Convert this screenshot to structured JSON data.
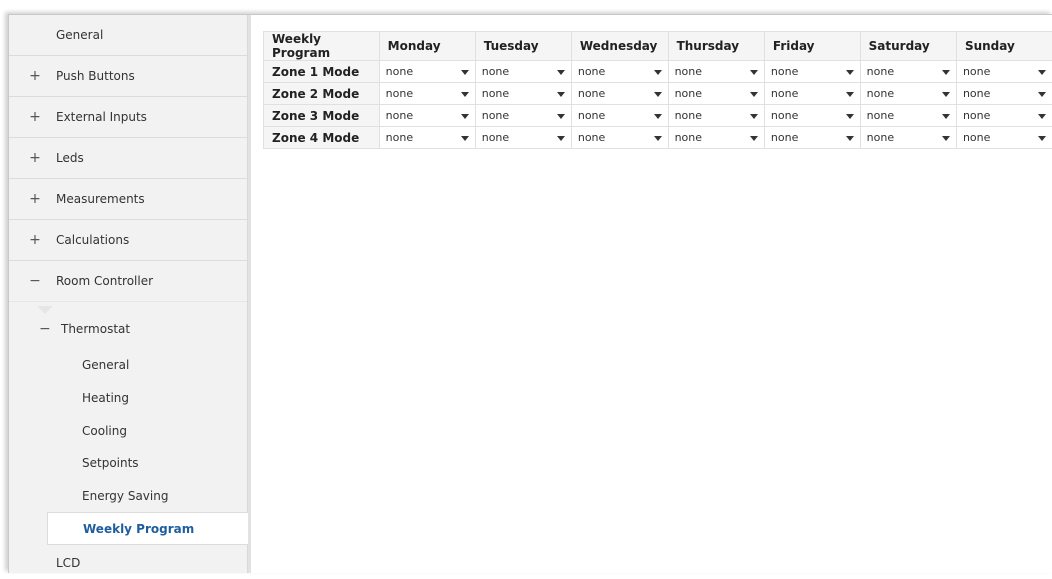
{
  "sidebar": {
    "items": [
      {
        "label": "General",
        "symbol": ""
      },
      {
        "label": "Push Buttons",
        "symbol": "+"
      },
      {
        "label": "External Inputs",
        "symbol": "+"
      },
      {
        "label": "Leds",
        "symbol": "+"
      },
      {
        "label": "Measurements",
        "symbol": "+"
      },
      {
        "label": "Calculations",
        "symbol": "+"
      },
      {
        "label": "Room Controller",
        "symbol": "−"
      }
    ],
    "thermostat": {
      "label": "Thermostat",
      "symbol": "−"
    },
    "sub_items": [
      {
        "label": "General"
      },
      {
        "label": "Heating"
      },
      {
        "label": "Cooling"
      },
      {
        "label": "Setpoints"
      },
      {
        "label": "Energy Saving"
      },
      {
        "label": "Weekly Program"
      }
    ],
    "lcd": {
      "label": "LCD"
    }
  },
  "table": {
    "header_label": "Weekly Program",
    "days": [
      "Monday",
      "Tuesday",
      "Wednesday",
      "Thursday",
      "Friday",
      "Saturday",
      "Sunday"
    ],
    "rows": [
      {
        "label": "Zone 1 Mode",
        "values": [
          "none",
          "none",
          "none",
          "none",
          "none",
          "none",
          "none"
        ]
      },
      {
        "label": "Zone 2 Mode",
        "values": [
          "none",
          "none",
          "none",
          "none",
          "none",
          "none",
          "none"
        ]
      },
      {
        "label": "Zone 3 Mode",
        "values": [
          "none",
          "none",
          "none",
          "none",
          "none",
          "none",
          "none"
        ]
      },
      {
        "label": "Zone 4 Mode",
        "values": [
          "none",
          "none",
          "none",
          "none",
          "none",
          "none",
          "none"
        ]
      }
    ]
  },
  "colors": {
    "accent": "#1f5e9e"
  }
}
